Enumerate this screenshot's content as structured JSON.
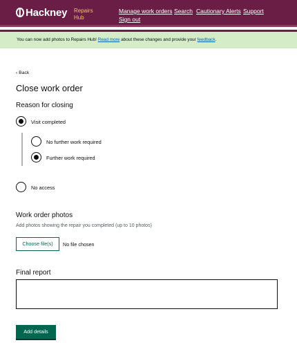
{
  "header": {
    "logo_text": "Hackney",
    "product_name": "Repairs Hub",
    "nav": [
      "Manage work orders",
      "Search",
      "Cautionary Alerts",
      "Support",
      "Sign out"
    ]
  },
  "banner": {
    "text_before": "You can now add photos to Repairs Hub! ",
    "link1": "Read more",
    "text_middle": " about these changes and provide your ",
    "link2": "feedback",
    "text_after": "."
  },
  "back_label": "Back",
  "page_title": "Close work order",
  "reason": {
    "heading": "Reason for closing",
    "options": [
      "Visit completed",
      "No access"
    ],
    "selected": "Visit completed",
    "sub_options": [
      "No further work required",
      "Further work required"
    ],
    "sub_selected": "Further work required"
  },
  "photos": {
    "heading": "Work order photos",
    "hint": "Add photos showing the repair you completed (up to 10 photos)",
    "button": "Choose file(s)",
    "status": "No file chosen"
  },
  "final_report": {
    "label": "Final report",
    "value": ""
  },
  "submit_label": "Add details",
  "colors": {
    "header": "#6a1e45",
    "accent_green": "#00664f",
    "banner_bg": "#d4ecc7",
    "logo_sub": "#f0c26b"
  }
}
